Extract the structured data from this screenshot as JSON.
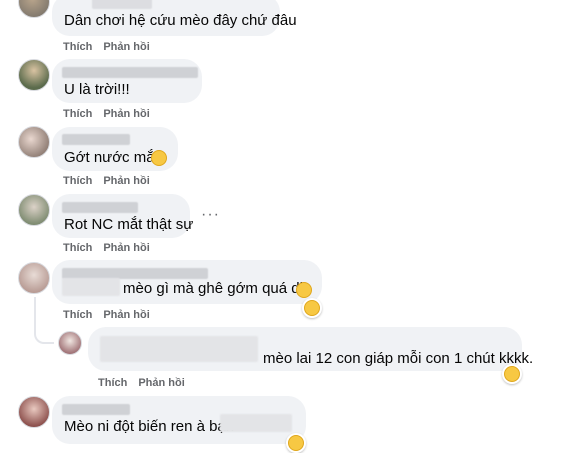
{
  "comments": [
    {
      "text": "Dân chơi hệ cứu mèo đây chứ đâu",
      "like": "Thích",
      "reply": "Phản hồi"
    },
    {
      "text": "U là trời!!!",
      "like": "Thích",
      "reply": "Phản hồi"
    },
    {
      "text": "Gớt nước mắt",
      "like": "Thích",
      "reply": "Phản hồi",
      "emoji": "crying-face"
    },
    {
      "text": "Rot NC mắt thật sự",
      "like": "Thích",
      "reply": "Phản hồi",
      "more": "···"
    },
    {
      "text": "mèo gì mà ghê gớm quá dị",
      "like": "Thích",
      "reply": "Phản hồi",
      "emoji": "sad-sweat-face",
      "reaction": "laughing-face"
    },
    {
      "text": "mèo lai 12 con giáp mỗi con 1 chút kkkk.",
      "like": "Thích",
      "reply": "Phản hồi",
      "reaction": "laughing-face"
    },
    {
      "text": "Mèo ni đột biến ren à bạn",
      "reaction": "laughing-face"
    }
  ],
  "colors": {
    "bubble": "#f0f2f5",
    "action": "#65676b",
    "text": "#050505"
  }
}
